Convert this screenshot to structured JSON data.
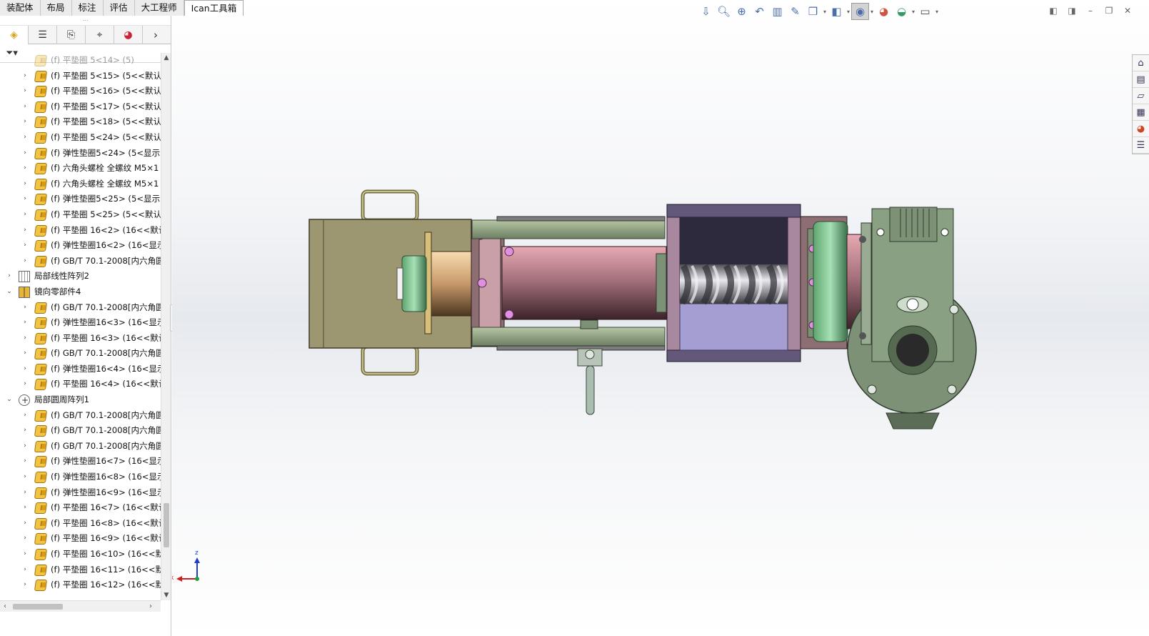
{
  "tabs": [
    "装配体",
    "布局",
    "标注",
    "评估",
    "大工程师",
    "Ican工具箱"
  ],
  "active_tab": "Ican工具箱",
  "feature_tree": [
    {
      "label": "(f) 平垫圈 5<14> (5)",
      "icon": "part-icon",
      "level": 2,
      "dim": true,
      "expander": ""
    },
    {
      "label": "(f) 平垫圈 5<15> (5<<默认",
      "icon": "part-icon",
      "level": 2,
      "expander": "›"
    },
    {
      "label": "(f) 平垫圈 5<16> (5<<默认",
      "icon": "part-icon",
      "level": 2,
      "expander": "›"
    },
    {
      "label": "(f) 平垫圈 5<17> (5<<默认",
      "icon": "part-icon",
      "level": 2,
      "expander": "›"
    },
    {
      "label": "(f) 平垫圈 5<18> (5<<默认",
      "icon": "part-icon",
      "level": 2,
      "expander": "›"
    },
    {
      "label": "(f) 平垫圈 5<24> (5<<默认",
      "icon": "part-icon",
      "level": 2,
      "expander": "›"
    },
    {
      "label": "(f) 弹性垫圈5<24> (5<显示",
      "icon": "part-icon",
      "level": 2,
      "expander": "›"
    },
    {
      "label": "(f) 六角头螺栓 全螺纹 M5×1",
      "icon": "part-icon",
      "level": 2,
      "expander": "›"
    },
    {
      "label": "(f) 六角头螺栓 全螺纹 M5×1",
      "icon": "part-icon",
      "level": 2,
      "expander": "›"
    },
    {
      "label": "(f) 弹性垫圈5<25> (5<显示",
      "icon": "part-icon",
      "level": 2,
      "expander": "›"
    },
    {
      "label": "(f) 平垫圈 5<25> (5<<默认",
      "icon": "part-icon",
      "level": 2,
      "expander": "›"
    },
    {
      "label": "(f) 平垫圈 16<2> (16<<默认",
      "icon": "part-icon",
      "level": 2,
      "expander": "›"
    },
    {
      "label": "(f) 弹性垫圈16<2> (16<显示",
      "icon": "part-icon",
      "level": 2,
      "expander": "›"
    },
    {
      "label": "(f) GB/T 70.1-2008[内六角圆",
      "icon": "part-icon",
      "level": 2,
      "expander": "›"
    },
    {
      "label": "局部线性阵列2",
      "icon": "pattern-icon",
      "level": 1,
      "expander": "›"
    },
    {
      "label": "镜向零部件4",
      "icon": "mirror-icon",
      "level": 1,
      "expander": "⌄"
    },
    {
      "label": "(f) GB/T 70.1-2008[内六角圆",
      "icon": "part-icon",
      "level": 2,
      "expander": "›"
    },
    {
      "label": "(f) 弹性垫圈16<3> (16<显示",
      "icon": "part-icon",
      "level": 2,
      "expander": "›"
    },
    {
      "label": "(f) 平垫圈 16<3> (16<<默认",
      "icon": "part-icon",
      "level": 2,
      "expander": "›"
    },
    {
      "label": "(f) GB/T 70.1-2008[内六角圆",
      "icon": "part-icon",
      "level": 2,
      "expander": "›"
    },
    {
      "label": "(f) 弹性垫圈16<4> (16<显示",
      "icon": "part-icon",
      "level": 2,
      "expander": "›"
    },
    {
      "label": "(f) 平垫圈 16<4> (16<<默认",
      "icon": "part-icon",
      "level": 2,
      "expander": "›"
    },
    {
      "label": "局部圆周阵列1",
      "icon": "circ-icon",
      "level": 1,
      "expander": "⌄"
    },
    {
      "label": "(f) GB/T 70.1-2008[内六角圆",
      "icon": "part-icon",
      "level": 2,
      "expander": "›"
    },
    {
      "label": "(f) GB/T 70.1-2008[内六角圆",
      "icon": "part-icon",
      "level": 2,
      "expander": "›"
    },
    {
      "label": "(f) GB/T 70.1-2008[内六角圆",
      "icon": "part-icon",
      "level": 2,
      "expander": "›"
    },
    {
      "label": "(f) 弹性垫圈16<7> (16<显示",
      "icon": "part-icon",
      "level": 2,
      "expander": "›"
    },
    {
      "label": "(f) 弹性垫圈16<8> (16<显示",
      "icon": "part-icon",
      "level": 2,
      "expander": "›"
    },
    {
      "label": "(f) 弹性垫圈16<9> (16<显示",
      "icon": "part-icon",
      "level": 2,
      "expander": "›"
    },
    {
      "label": "(f) 平垫圈 16<7> (16<<默认",
      "icon": "part-icon",
      "level": 2,
      "expander": "›"
    },
    {
      "label": "(f) 平垫圈 16<8> (16<<默认",
      "icon": "part-icon",
      "level": 2,
      "expander": "›"
    },
    {
      "label": "(f) 平垫圈 16<9> (16<<默认",
      "icon": "part-icon",
      "level": 2,
      "expander": "›"
    },
    {
      "label": "(f) 平垫圈 16<10> (16<<默",
      "icon": "part-icon",
      "level": 2,
      "expander": "›"
    },
    {
      "label": "(f) 平垫圈 16<11> (16<<默",
      "icon": "part-icon",
      "level": 2,
      "expander": "›"
    },
    {
      "label": "(f) 平垫圈 16<12> (16<<默",
      "icon": "part-icon",
      "level": 2,
      "expander": "›"
    }
  ],
  "panel_tabs": [
    "feature-manager-icon",
    "property-manager-icon",
    "configuration-manager-icon",
    "dimxpert-icon",
    "display-manager-icon"
  ],
  "heads_up_toolbar": [
    "view-orientation-icon",
    "zoom-to-fit-icon",
    "zoom-area-icon",
    "previous-view-icon",
    "section-view-icon",
    "dynamic-annotation-icon",
    "view-settings-icon",
    "display-style-icon",
    "hide-show-icon",
    "edit-appearance-icon",
    "apply-scene-icon",
    "view-settings-monitor-icon"
  ],
  "task_pane": [
    "home-icon",
    "design-library-icon",
    "file-explorer-icon",
    "view-palette-icon",
    "appearances-icon",
    "custom-properties-icon"
  ],
  "triad": {
    "up_label": "z",
    "left_label": "x"
  },
  "colors": {
    "housing": "#9c9770",
    "cylinder": "#a5707b",
    "motor": "#7d9177",
    "hopper": "#2e2a3e",
    "bolt": "#e38fe0"
  }
}
